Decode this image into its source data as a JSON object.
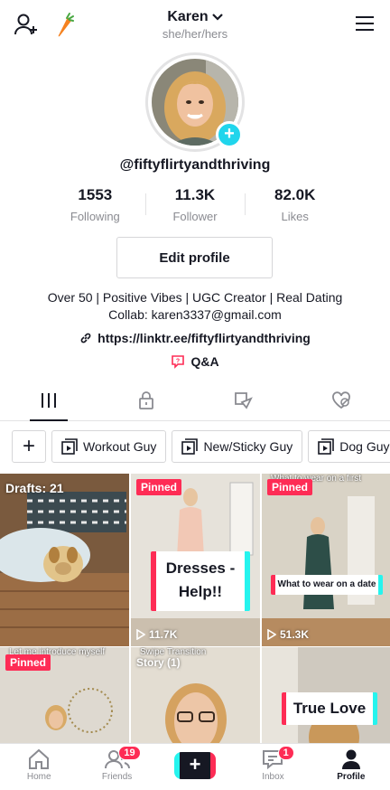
{
  "header": {
    "name": "Karen",
    "pronouns": "she/her/hers",
    "carrot_emoji": "🥕"
  },
  "profile": {
    "username": "@fiftyflirtyandthriving",
    "stats": [
      {
        "value": "1553",
        "label": "Following"
      },
      {
        "value": "11.3K",
        "label": "Follower"
      },
      {
        "value": "82.0K",
        "label": "Likes"
      }
    ],
    "edit_button": "Edit profile",
    "bio_line1": "Over 50 | Positive Vibes | UGC Creator | Real Dating",
    "bio_line2": "Collab: karen3337@gmail.com",
    "link": "https://linktr.ee/fiftyflirtyandthriving",
    "qa": "Q&A"
  },
  "playlists": [
    "Workout Guy",
    "New/Sticky Guy",
    "Dog Guy"
  ],
  "videos": {
    "drafts": "Drafts: 21",
    "pinned": "Pinned",
    "v2_card": "Dresses - Help!!",
    "v2_views": "11.7K",
    "v3_caption": "What to wear on a first date...",
    "v3_card": "What to wear on a date",
    "v3_views": "51.3K",
    "v4_caption": "Let me introduce myself",
    "v5_caption": "Swipe Transition",
    "v5_badge": "Story (1)",
    "v6_card": "True Love"
  },
  "nav": {
    "home": "Home",
    "friends": "Friends",
    "friends_badge": "19",
    "inbox": "Inbox",
    "inbox_badge": "1",
    "profile": "Profile"
  },
  "colors": {
    "accent_red": "#fe2c55",
    "accent_cyan": "#20d5ec",
    "text_primary": "#161823",
    "text_secondary": "#8a8b91"
  }
}
